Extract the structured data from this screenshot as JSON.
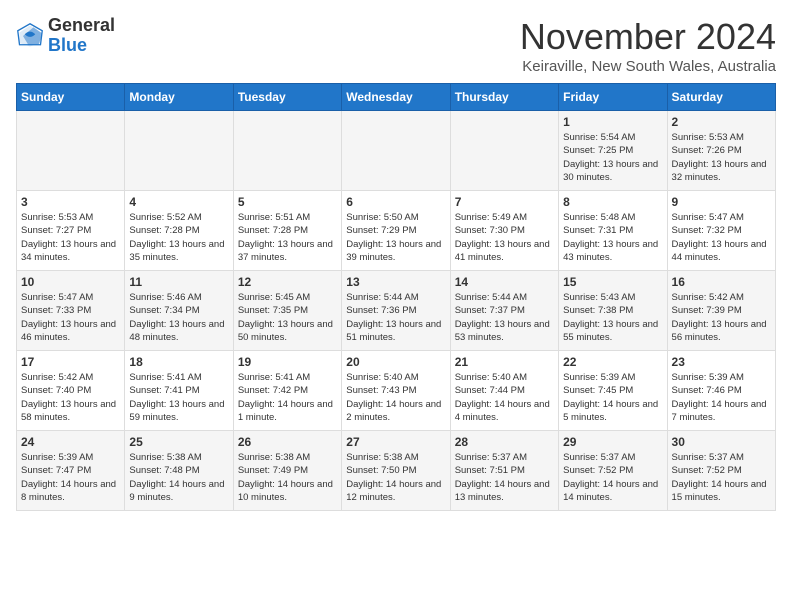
{
  "header": {
    "logo": {
      "general": "General",
      "blue": "Blue"
    },
    "title": "November 2024",
    "location": "Keiraville, New South Wales, Australia"
  },
  "calendar": {
    "days_of_week": [
      "Sunday",
      "Monday",
      "Tuesday",
      "Wednesday",
      "Thursday",
      "Friday",
      "Saturday"
    ],
    "weeks": [
      [
        {
          "day": "",
          "info": ""
        },
        {
          "day": "",
          "info": ""
        },
        {
          "day": "",
          "info": ""
        },
        {
          "day": "",
          "info": ""
        },
        {
          "day": "",
          "info": ""
        },
        {
          "day": "1",
          "info": "Sunrise: 5:54 AM\nSunset: 7:25 PM\nDaylight: 13 hours and 30 minutes."
        },
        {
          "day": "2",
          "info": "Sunrise: 5:53 AM\nSunset: 7:26 PM\nDaylight: 13 hours and 32 minutes."
        }
      ],
      [
        {
          "day": "3",
          "info": "Sunrise: 5:53 AM\nSunset: 7:27 PM\nDaylight: 13 hours and 34 minutes."
        },
        {
          "day": "4",
          "info": "Sunrise: 5:52 AM\nSunset: 7:28 PM\nDaylight: 13 hours and 35 minutes."
        },
        {
          "day": "5",
          "info": "Sunrise: 5:51 AM\nSunset: 7:28 PM\nDaylight: 13 hours and 37 minutes."
        },
        {
          "day": "6",
          "info": "Sunrise: 5:50 AM\nSunset: 7:29 PM\nDaylight: 13 hours and 39 minutes."
        },
        {
          "day": "7",
          "info": "Sunrise: 5:49 AM\nSunset: 7:30 PM\nDaylight: 13 hours and 41 minutes."
        },
        {
          "day": "8",
          "info": "Sunrise: 5:48 AM\nSunset: 7:31 PM\nDaylight: 13 hours and 43 minutes."
        },
        {
          "day": "9",
          "info": "Sunrise: 5:47 AM\nSunset: 7:32 PM\nDaylight: 13 hours and 44 minutes."
        }
      ],
      [
        {
          "day": "10",
          "info": "Sunrise: 5:47 AM\nSunset: 7:33 PM\nDaylight: 13 hours and 46 minutes."
        },
        {
          "day": "11",
          "info": "Sunrise: 5:46 AM\nSunset: 7:34 PM\nDaylight: 13 hours and 48 minutes."
        },
        {
          "day": "12",
          "info": "Sunrise: 5:45 AM\nSunset: 7:35 PM\nDaylight: 13 hours and 50 minutes."
        },
        {
          "day": "13",
          "info": "Sunrise: 5:44 AM\nSunset: 7:36 PM\nDaylight: 13 hours and 51 minutes."
        },
        {
          "day": "14",
          "info": "Sunrise: 5:44 AM\nSunset: 7:37 PM\nDaylight: 13 hours and 53 minutes."
        },
        {
          "day": "15",
          "info": "Sunrise: 5:43 AM\nSunset: 7:38 PM\nDaylight: 13 hours and 55 minutes."
        },
        {
          "day": "16",
          "info": "Sunrise: 5:42 AM\nSunset: 7:39 PM\nDaylight: 13 hours and 56 minutes."
        }
      ],
      [
        {
          "day": "17",
          "info": "Sunrise: 5:42 AM\nSunset: 7:40 PM\nDaylight: 13 hours and 58 minutes."
        },
        {
          "day": "18",
          "info": "Sunrise: 5:41 AM\nSunset: 7:41 PM\nDaylight: 13 hours and 59 minutes."
        },
        {
          "day": "19",
          "info": "Sunrise: 5:41 AM\nSunset: 7:42 PM\nDaylight: 14 hours and 1 minute."
        },
        {
          "day": "20",
          "info": "Sunrise: 5:40 AM\nSunset: 7:43 PM\nDaylight: 14 hours and 2 minutes."
        },
        {
          "day": "21",
          "info": "Sunrise: 5:40 AM\nSunset: 7:44 PM\nDaylight: 14 hours and 4 minutes."
        },
        {
          "day": "22",
          "info": "Sunrise: 5:39 AM\nSunset: 7:45 PM\nDaylight: 14 hours and 5 minutes."
        },
        {
          "day": "23",
          "info": "Sunrise: 5:39 AM\nSunset: 7:46 PM\nDaylight: 14 hours and 7 minutes."
        }
      ],
      [
        {
          "day": "24",
          "info": "Sunrise: 5:39 AM\nSunset: 7:47 PM\nDaylight: 14 hours and 8 minutes."
        },
        {
          "day": "25",
          "info": "Sunrise: 5:38 AM\nSunset: 7:48 PM\nDaylight: 14 hours and 9 minutes."
        },
        {
          "day": "26",
          "info": "Sunrise: 5:38 AM\nSunset: 7:49 PM\nDaylight: 14 hours and 10 minutes."
        },
        {
          "day": "27",
          "info": "Sunrise: 5:38 AM\nSunset: 7:50 PM\nDaylight: 14 hours and 12 minutes."
        },
        {
          "day": "28",
          "info": "Sunrise: 5:37 AM\nSunset: 7:51 PM\nDaylight: 14 hours and 13 minutes."
        },
        {
          "day": "29",
          "info": "Sunrise: 5:37 AM\nSunset: 7:52 PM\nDaylight: 14 hours and 14 minutes."
        },
        {
          "day": "30",
          "info": "Sunrise: 5:37 AM\nSunset: 7:52 PM\nDaylight: 14 hours and 15 minutes."
        }
      ]
    ]
  }
}
